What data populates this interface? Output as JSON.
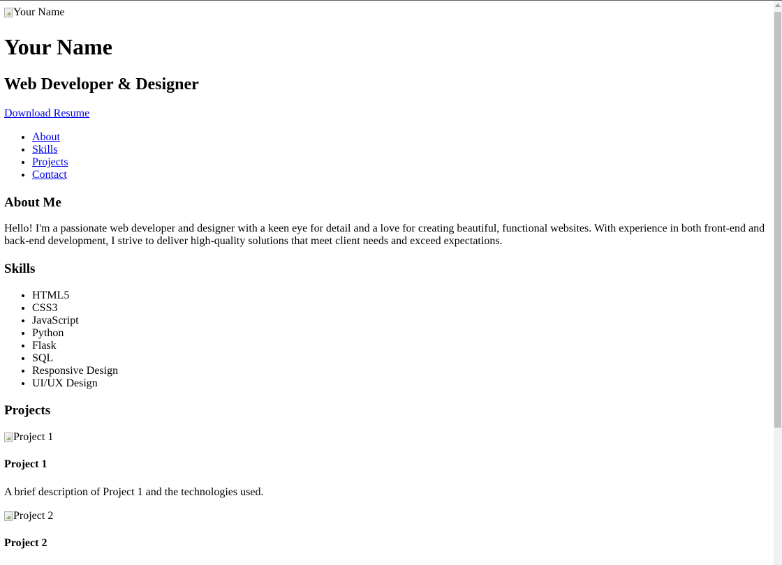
{
  "header": {
    "profile_image_alt": "Your Name",
    "name": "Your Name",
    "tagline": "Web Developer & Designer",
    "resume_link": "Download Resume"
  },
  "nav": {
    "items": [
      {
        "label": "About"
      },
      {
        "label": "Skills"
      },
      {
        "label": "Projects"
      },
      {
        "label": "Contact"
      }
    ]
  },
  "about": {
    "heading": "About Me",
    "text": "Hello! I'm a passionate web developer and designer with a keen eye for detail and a love for creating beautiful, functional websites. With experience in both front-end and back-end development, I strive to deliver high-quality solutions that meet client needs and exceed expectations."
  },
  "skills": {
    "heading": "Skills",
    "items": [
      "HTML5",
      "CSS3",
      "JavaScript",
      "Python",
      "Flask",
      "SQL",
      "Responsive Design",
      "UI/UX Design"
    ]
  },
  "projects": {
    "heading": "Projects",
    "items": [
      {
        "image_alt": "Project 1",
        "title": "Project 1",
        "description": "A brief description of Project 1 and the technologies used."
      },
      {
        "image_alt": "Project 2",
        "title": "Project 2"
      }
    ]
  },
  "colors": {
    "link": "#0000ee",
    "scrollbar_thumb": "#c1c1c1",
    "scrollbar_track": "#f1f1f1"
  }
}
